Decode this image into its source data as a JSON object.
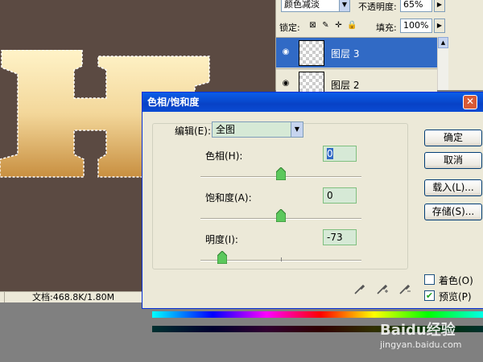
{
  "layers_panel": {
    "blend_mode": "颜色减淡",
    "opacity_label": "不透明度:",
    "opacity_value": "65%",
    "lock_label": "锁定:",
    "fill_label": "填充:",
    "fill_value": "100%",
    "layers": [
      {
        "name": "图层 3",
        "selected": true
      },
      {
        "name": "图层 2",
        "selected": false
      }
    ]
  },
  "status_bar": {
    "doc_info": "文档:468.8K/1.80M"
  },
  "dialog": {
    "title": "色相/饱和度",
    "edit_label": "编辑(E):",
    "edit_value": "全图",
    "params": [
      {
        "label": "色相(H):",
        "value": "0",
        "slider": 0
      },
      {
        "label": "饱和度(A):",
        "value": "0",
        "slider": 0
      },
      {
        "label": "明度(I):",
        "value": "-73",
        "slider": -73
      }
    ],
    "buttons": {
      "ok": "确定",
      "cancel": "取消",
      "load": "载入(L)...",
      "save": "存储(S)..."
    },
    "colorize_label": "着色(O)",
    "colorize_checked": false,
    "preview_label": "预览(P)",
    "preview_checked": true
  },
  "watermark": {
    "brand": "Baidu经验",
    "url": "jingyan.baidu.com"
  },
  "colors": {
    "canvas_bg": "#5b4a42",
    "selection_blue": "#316ac5",
    "title_blue": "#0842c6",
    "field_green": "#d6e9d6"
  }
}
